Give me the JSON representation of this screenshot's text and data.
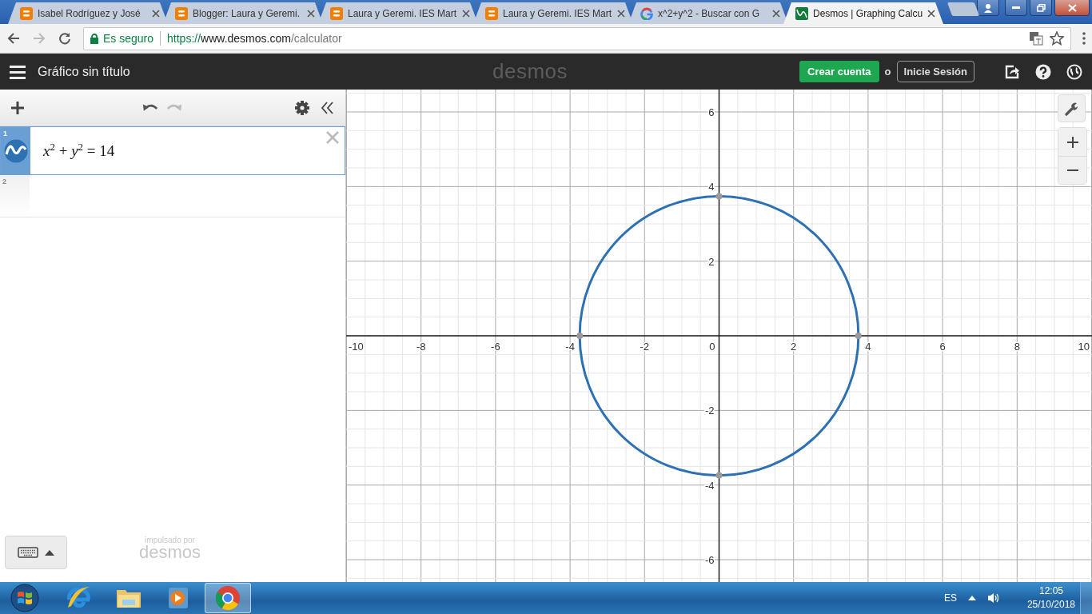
{
  "browser": {
    "tabs": [
      {
        "kind": "blog",
        "title": "Isabel Rodríguez y José",
        "selected": false
      },
      {
        "kind": "blog",
        "title": "Blogger: Laura y Geremi.",
        "selected": false
      },
      {
        "kind": "blog",
        "title": "Laura y Geremi. IES Mart",
        "selected": false
      },
      {
        "kind": "blog",
        "title": "Laura y Geremi. IES Mart",
        "selected": false
      },
      {
        "kind": "search",
        "title": "x^2+y^2 - Buscar con G",
        "selected": false
      },
      {
        "kind": "graph",
        "title": "Desmos | Graphing Calcu",
        "selected": true
      }
    ],
    "security": "Es seguro",
    "url": {
      "scheme": "https://",
      "host": "www.desmos.com",
      "path": "/calculator"
    }
  },
  "header": {
    "title": "Gráfico sin título",
    "logo": "desmos",
    "signup": "Crear cuenta",
    "or": "o",
    "login": "Inicie Sesión"
  },
  "expressions": [
    {
      "number": "1",
      "kind": "expression",
      "latex": "*x*$^{2}$ + *y*$^{2}$ = 14",
      "selected": true
    },
    {
      "number": "2",
      "kind": "blank",
      "selected": false
    }
  ],
  "branding": {
    "caption": "impulsado por",
    "logo": "desmos"
  },
  "graph": {
    "chart_data": {
      "type": "scatter",
      "xlim": [
        -10.01,
        10.01
      ],
      "ylim": [
        -6.62,
        6.6
      ],
      "xticks": [
        -10,
        -8,
        -6,
        -4,
        -2,
        2,
        4,
        6,
        8,
        10
      ],
      "yticks": [
        -6,
        -4,
        -2,
        2,
        4,
        6
      ],
      "x": [
        -3.74,
        0,
        0,
        3.74
      ],
      "series": [
        {
          "color": "#9a9a9a",
          "values": [
            0,
            3.74,
            -3.74,
            0
          ]
        }
      ],
      "grid": true
    },
    "origin_label": "0"
  },
  "taskbar": {
    "apps": [
      {
        "kind": "ie",
        "selected": false
      },
      {
        "kind": "explorer",
        "selected": false
      },
      {
        "kind": "media",
        "selected": false
      },
      {
        "kind": "chrome",
        "selected": true
      }
    ],
    "language": "ES",
    "time": "12:05",
    "date": "25/10/2018"
  }
}
